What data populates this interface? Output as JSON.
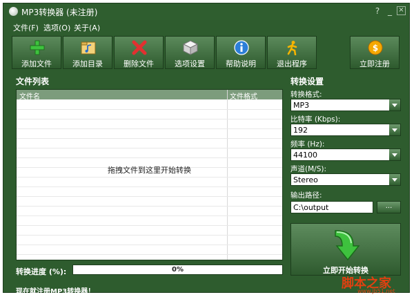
{
  "window": {
    "title": "MP3转换器 (未注册)",
    "controls": [
      "?",
      "_",
      "×"
    ]
  },
  "menu": [
    "文件(F)",
    "选项(O)",
    "关于(A)"
  ],
  "toolbar": {
    "add_file": "添加文件",
    "add_dir": "添加目录",
    "delete_file": "删除文件",
    "options": "选项设置",
    "help": "帮助说明",
    "exit": "退出程序",
    "register": "立即注册"
  },
  "file_list": {
    "title": "文件列表",
    "col_name": "文件名",
    "col_format": "文件格式",
    "drop_hint": "拖拽文件到这里开始转换"
  },
  "progress": {
    "label": "转换进度 (%):",
    "value_text": "0%",
    "value": 0
  },
  "settings": {
    "title": "转换设置",
    "format_label": "转换格式:",
    "format_value": "MP3",
    "bitrate_label": "比特率 (Kbps):",
    "bitrate_value": "192",
    "freq_label": "频率 (Hz):",
    "freq_value": "44100",
    "channel_label": "声道(M/S):",
    "channel_value": "Stereo",
    "output_label": "输出路径:",
    "output_value": "C:\\output",
    "browse_label": "...",
    "start_label": "立即开始转换"
  },
  "footer": {
    "register_link": "现在就注册MP3转换器！"
  },
  "watermark": {
    "text": "脚本之家",
    "sub": "www.jb51.net"
  },
  "colors": {
    "window_bg": "#2e5c2e",
    "accent_orange": "#e04010"
  }
}
